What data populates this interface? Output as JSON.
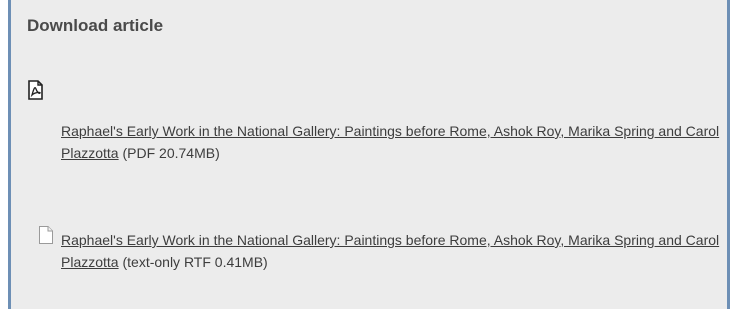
{
  "panel": {
    "title": "Download article"
  },
  "downloads": [
    {
      "icon": "pdf-icon",
      "link_text": "Raphael's Early Work in the National Gallery: Paintings before Rome, Ashok Roy, Marika Spring and Carol Plazzotta",
      "suffix": " (PDF 20.74MB)"
    },
    {
      "icon": "document-icon",
      "link_text": "Raphael's Early Work in the National Gallery: Paintings before Rome, Ashok Roy, Marika Spring and Carol Plazzotta",
      "suffix": " (text-only RTF 0.41MB)"
    }
  ]
}
